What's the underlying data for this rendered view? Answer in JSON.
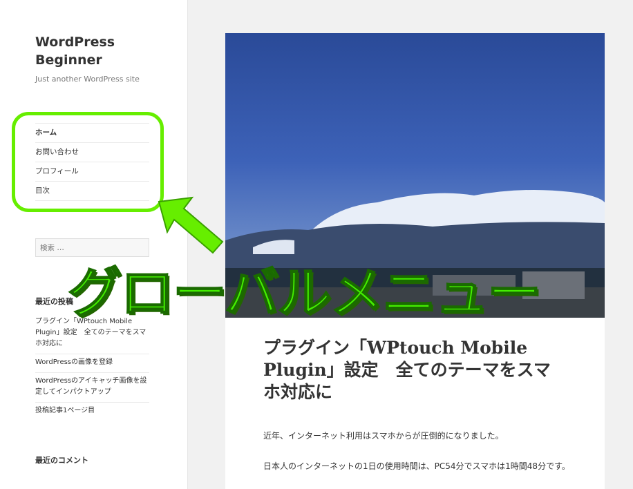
{
  "site": {
    "title": "WordPress Beginner",
    "description": "Just another WordPress site"
  },
  "nav": {
    "items": [
      {
        "label": "ホーム",
        "current": true
      },
      {
        "label": "お問い合わせ"
      },
      {
        "label": "プロフィール"
      },
      {
        "label": "目次"
      }
    ]
  },
  "search": {
    "placeholder": "検索 …"
  },
  "widgets": {
    "recent_posts": {
      "title": "最近の投稿",
      "items": [
        "プラグイン「WPtouch Mobile Plugin」設定　全てのテーマをスマホ対応に",
        "WordPressの画像を登録",
        "WordPressのアイキャッチ画像を設定してインパクトアップ",
        "投稿記事1ページ目"
      ]
    },
    "recent_comments": {
      "title": "最近のコメント"
    }
  },
  "post": {
    "title_prefix": "プラグイン「",
    "title_bold": "WPtouch Mobile Plugin",
    "title_suffix": "」設定　全てのテーマをスマホ対応に",
    "paragraphs": [
      "近年、インターネット利用はスマホからが圧倒的になりました。",
      "日本人のインターネットの1日の使用時間は、PC54分でスマホは1時間48分です。"
    ]
  },
  "annotation": {
    "label": "グローバルメニュー",
    "color": "#44ee00"
  }
}
